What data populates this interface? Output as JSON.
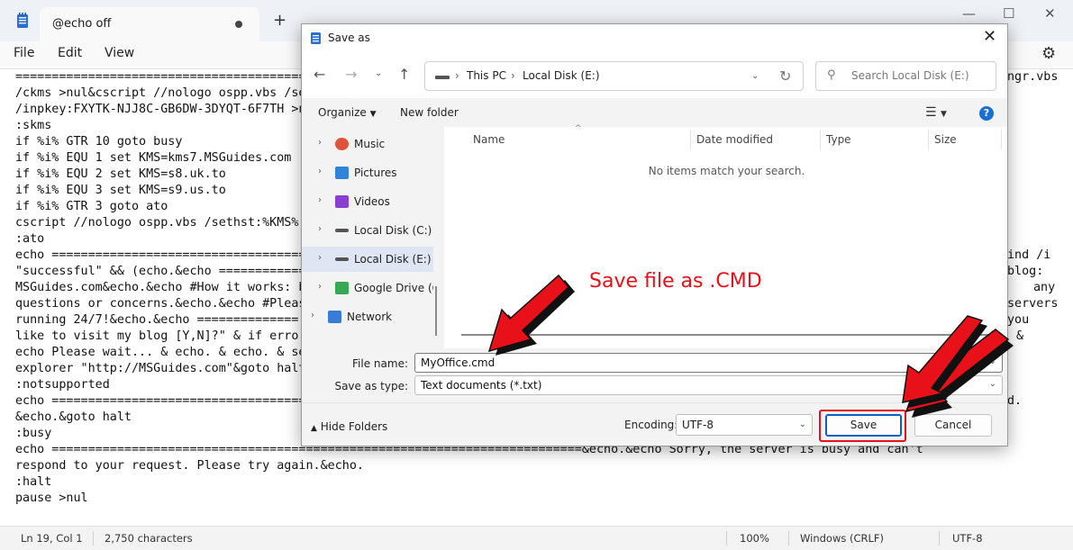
{
  "notepad": {
    "tab_title": "@echo off",
    "menu": [
      "File",
      "Edit",
      "View"
    ],
    "lines_left": [
      "========================================",
      "/ckms >nul&cscript //nologo ospp.vbs /se",
      "/inpkey:FXYTK-NJJ8C-GB6DW-3DYQT-6F7TH >n",
      ":skms",
      "if %i% GTR 10 goto busy",
      "if %i% EQU 1 set KMS=kms7.MSGuides.com",
      "if %i% EQU 2 set KMS=s8.uk.to",
      "if %i% EQU 3 set KMS=s9.us.to",
      "if %i% GTR 3 goto ato",
      "cscript //nologo ospp.vbs /sethst:%KMS%",
      ":ato",
      "echo ===================================",
      "\"successful\" && (echo.&echo ============",
      "MSGuides.com&echo.&echo #How it works: b",
      "questions or concerns.&echo.&echo #Pleas",
      "running 24/7!&echo.&echo ==============",
      "like to visit my blog [Y,N]?\" & if erro",
      "echo Please wait... & echo. & echo. & se",
      "explorer \"http://MSGuides.com\"&goto halt",
      ":notsupported",
      "echo ===================================",
      "&echo.&goto halt",
      ":busy",
      "echo =========================================================================&echo.&echo Sorry, the server is busy and can't",
      "respond to your request. Please try again.&echo.",
      ":halt",
      "pause >nul"
    ],
    "lines_right": [
      {
        "text": "ngr.vbs"
      },
      {
        "text": "ind /i"
      },
      {
        "text": "blog:"
      },
      {
        "text": "any"
      },
      {
        "text": "servers"
      },
      {
        "text": "you"
      },
      {
        "text": "&"
      },
      {
        "text": "d."
      }
    ],
    "status": {
      "position": "Ln 19, Col 1",
      "chars": "2,750 characters",
      "zoom": "100%",
      "line_ending": "Windows (CRLF)",
      "encoding": "UTF-8"
    }
  },
  "dialog": {
    "title": "Save as",
    "breadcrumb": [
      "This PC",
      "Local Disk (E:)"
    ],
    "search_placeholder": "Search Local Disk (E:)",
    "organize_label": "Organize",
    "new_folder_label": "New folder",
    "nav_items": [
      {
        "label": "Music",
        "icon": "music-icon",
        "color": "#e0533a"
      },
      {
        "label": "Pictures",
        "icon": "pictures-icon",
        "color": "#2f84d8"
      },
      {
        "label": "Videos",
        "icon": "videos-icon",
        "color": "#8a3fd1"
      },
      {
        "label": "Local Disk (C:)",
        "icon": "drive-icon",
        "color": "#555555"
      },
      {
        "label": "Local Disk (E:)",
        "icon": "drive-icon",
        "color": "#555555"
      },
      {
        "label": "Google Drive (C",
        "icon": "google-drive-icon",
        "color": "#34a853"
      },
      {
        "label": "Network",
        "icon": "network-icon",
        "color": "#3a7bd5"
      }
    ],
    "columns": [
      "Name",
      "Date modified",
      "Type",
      "Size"
    ],
    "empty_message": "No items match your search.",
    "file_name_label": "File name:",
    "file_name_value": "MyOffice.cmd",
    "save_type_label": "Save as type:",
    "save_type_value": "Text documents (*.txt)",
    "hide_folders_label": "Hide Folders",
    "encoding_label": "Encoding:",
    "encoding_value": "UTF-8",
    "save_label": "Save",
    "cancel_label": "Cancel"
  },
  "annotation": {
    "text": "Save file as .CMD",
    "color": "#e8111a"
  }
}
